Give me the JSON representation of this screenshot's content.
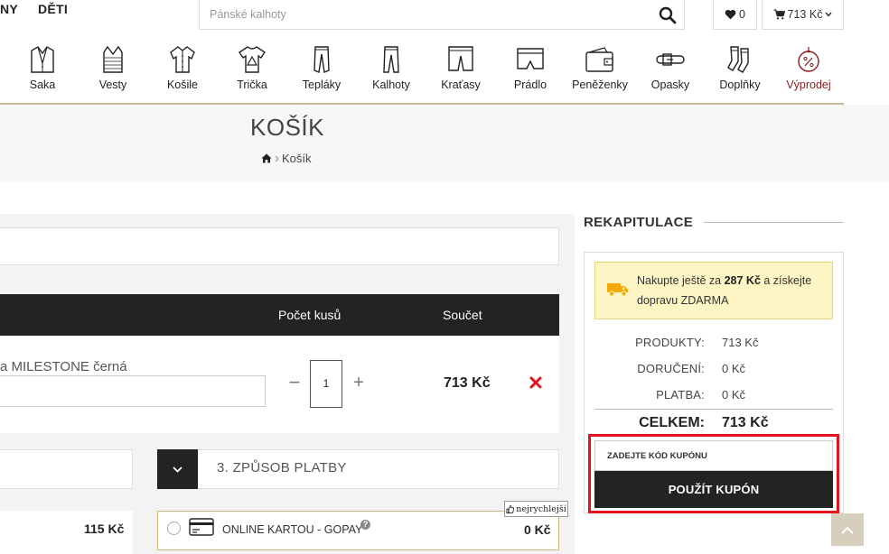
{
  "nav": {
    "link1": "NY",
    "link2": "DĚTI"
  },
  "search": {
    "placeholder": "Pánské kalhoty"
  },
  "wishlist": {
    "count": "0"
  },
  "cart": {
    "amount": "713 Kč"
  },
  "categories": [
    {
      "label": "Saka",
      "icon": "blazer-icon"
    },
    {
      "label": "Vesty",
      "icon": "vest-icon"
    },
    {
      "label": "Košile",
      "icon": "shirt-icon"
    },
    {
      "label": "Trička",
      "icon": "tshirt-icon"
    },
    {
      "label": "Tepláky",
      "icon": "sweatpants-icon"
    },
    {
      "label": "Kalhoty",
      "icon": "trousers-icon"
    },
    {
      "label": "Kraťasy",
      "icon": "shorts-icon"
    },
    {
      "label": "Prádlo",
      "icon": "underwear-icon"
    },
    {
      "label": "Peněženky",
      "icon": "wallet-icon"
    },
    {
      "label": "Opasky",
      "icon": "belt-icon"
    },
    {
      "label": "Doplňky",
      "icon": "socks-icon"
    },
    {
      "label": "Výprodej",
      "icon": "sale-tag-icon"
    }
  ],
  "page": {
    "title": "KOŠÍK",
    "breadcrumb": "Košík"
  },
  "cart_table": {
    "col_qty": "Počet kusů",
    "col_sum": "Součet",
    "item": {
      "name": "a MILESTONE černá",
      "qty": "1",
      "sum": "713 Kč"
    }
  },
  "checkout": {
    "payment_title": "3. ZPŮSOB PLATBY",
    "shipping_price": "115 Kč",
    "pay_option": {
      "label": "ONLINE KARTOU - GOPAY",
      "price": "0 Kč",
      "badge": "nejrychlejší"
    }
  },
  "summary": {
    "title": "REKAPITULACE",
    "free_ship_pre": "Nakupte ještě za ",
    "free_ship_amount": "287 Kč",
    "free_ship_post": " a získejte dopravu ZDARMA",
    "products_label": "PRODUKTY:",
    "products_value": "713 Kč",
    "delivery_label": "DORUČENÍ:",
    "delivery_value": "0 Kč",
    "payment_label": "PLATBA:",
    "payment_value": "0 Kč",
    "total_label": "CELKEM:",
    "total_value": "713 Kč",
    "coupon_placeholder": "ZADEJTE KÓD KUPÓNU",
    "coupon_button": "POUŽÍT KUPÓN"
  },
  "colors": {
    "dark": "#232323",
    "accent_line": "#c9b99a",
    "sale_red": "#8b1a1a",
    "highlight_red": "#e3141b",
    "notice_yellow": "#fdf5c3"
  }
}
